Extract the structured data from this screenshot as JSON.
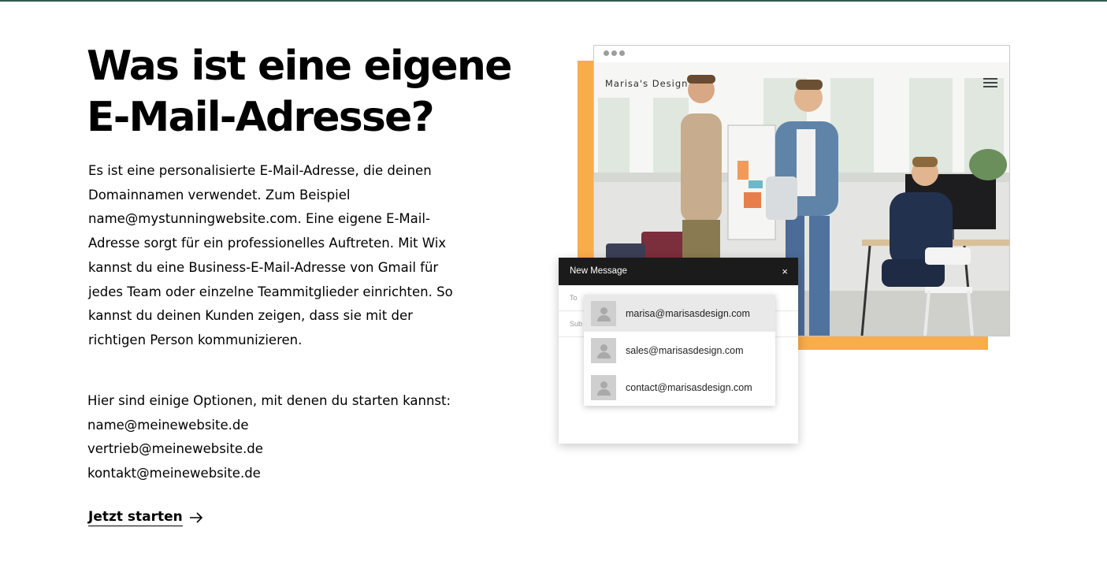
{
  "heading": {
    "line1": "Was ist eine eigene",
    "line2": "E-Mail-Adresse?"
  },
  "intro_lines": [
    "Es ist eine personalisierte E-Mail-Adresse, die deinen",
    "Domainnamen verwendet. Zum Beispiel",
    "name@mystunningwebsite.com. Eine eigene E-Mail-",
    "Adresse sorgt für ein professionelles Auftreten. Mit Wix",
    "kannst du eine Business-E-Mail-Adresse von Gmail für",
    "jedes Team oder einzelne Teammitglieder einrichten. So",
    "kannst du deinen Kunden zeigen, dass sie mit der",
    "richtigen Person kommunizieren."
  ],
  "options": {
    "lead": "Hier sind einige Optionen, mit denen du starten kannst:",
    "items": [
      "name@meinewebsite.de",
      "vertrieb@meinewebsite.de",
      "kontakt@meinewebsite.de"
    ]
  },
  "cta": {
    "label": "Jetzt starten",
    "icon": "arrow-right-icon"
  },
  "mockup": {
    "site_title": "Marisa's Design",
    "menu_icon": "hamburger-menu-icon",
    "compose": {
      "title": "New Message",
      "close_glyph": "×",
      "to_label": "To",
      "subject_label": "Sub"
    },
    "suggestions": [
      {
        "email": "marisa@marisasdesign.com",
        "selected": true
      },
      {
        "email": "sales@marisasdesign.com",
        "selected": false
      },
      {
        "email": "contact@marisasdesign.com",
        "selected": false
      }
    ]
  },
  "colors": {
    "accent_orange": "#f9ac4a",
    "top_line": "#2f5a4f",
    "compose_header": "#1b1b1b"
  }
}
